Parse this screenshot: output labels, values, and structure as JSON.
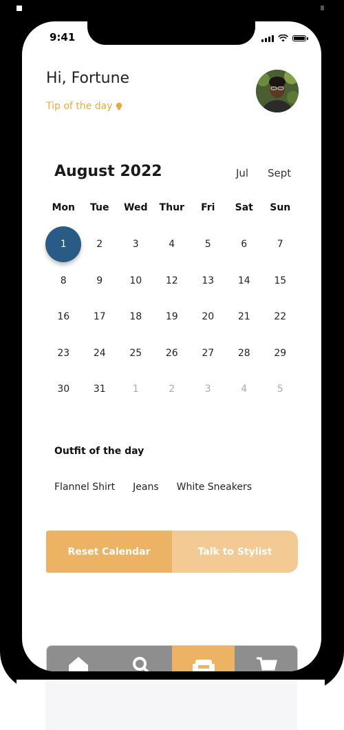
{
  "status_bar": {
    "time": "9:41"
  },
  "header": {
    "greeting": "Hi, Fortune",
    "tip": "Tip of the day"
  },
  "calendar": {
    "month_title": "August 2022",
    "prev_month": "Jul",
    "next_month": "Sept",
    "weekdays": [
      "Mon",
      "Tue",
      "Wed",
      "Thur",
      "Fri",
      "Sat",
      "Sun"
    ],
    "days": [
      {
        "label": "1",
        "muted": false,
        "selected": true
      },
      {
        "label": "2",
        "muted": false
      },
      {
        "label": "3",
        "muted": false
      },
      {
        "label": "4",
        "muted": false
      },
      {
        "label": "5",
        "muted": false
      },
      {
        "label": "6",
        "muted": false
      },
      {
        "label": "7",
        "muted": false
      },
      {
        "label": "8",
        "muted": false
      },
      {
        "label": "9",
        "muted": false
      },
      {
        "label": "10",
        "muted": false
      },
      {
        "label": "12",
        "muted": false
      },
      {
        "label": "13",
        "muted": false
      },
      {
        "label": "14",
        "muted": false
      },
      {
        "label": "15",
        "muted": false
      },
      {
        "label": "16",
        "muted": false
      },
      {
        "label": "17",
        "muted": false
      },
      {
        "label": "18",
        "muted": false
      },
      {
        "label": "19",
        "muted": false
      },
      {
        "label": "20",
        "muted": false
      },
      {
        "label": "21",
        "muted": false
      },
      {
        "label": "22",
        "muted": false
      },
      {
        "label": "23",
        "muted": false
      },
      {
        "label": "24",
        "muted": false
      },
      {
        "label": "25",
        "muted": false
      },
      {
        "label": "26",
        "muted": false
      },
      {
        "label": "27",
        "muted": false
      },
      {
        "label": "28",
        "muted": false
      },
      {
        "label": "29",
        "muted": false
      },
      {
        "label": "30",
        "muted": false
      },
      {
        "label": "31",
        "muted": false
      },
      {
        "label": "1",
        "muted": true
      },
      {
        "label": "2",
        "muted": true
      },
      {
        "label": "3",
        "muted": true
      },
      {
        "label": "4",
        "muted": true
      },
      {
        "label": "5",
        "muted": true
      }
    ]
  },
  "outfit": {
    "title": "Outfit of the day",
    "items": [
      "Flannel Shirt",
      "Jeans",
      "White Sneakers"
    ]
  },
  "actions": {
    "reset_label": "Reset Calendar",
    "stylist_label": "Talk to Stylist"
  },
  "bottom_nav": {
    "items": [
      {
        "icon": "home-icon",
        "active": false
      },
      {
        "icon": "search-icon",
        "active": false
      },
      {
        "icon": "wardrobe-icon",
        "active": true
      },
      {
        "icon": "cart-icon",
        "active": false
      }
    ]
  },
  "colors": {
    "accent": "#ebb363",
    "accent_light": "#f3ca93",
    "selected_day": "#2a5b86",
    "tip_text": "#e8a93f",
    "nav_inactive": "#8e8e8e"
  }
}
